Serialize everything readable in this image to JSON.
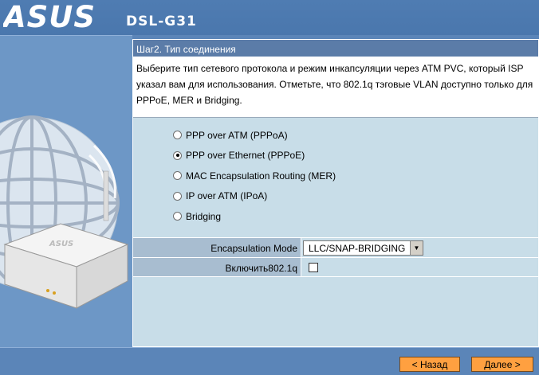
{
  "header": {
    "brand": "ASUS",
    "model": "DSL-G31"
  },
  "step": {
    "title": "Шаг2. Тип соединения",
    "description": "Выберите тип сетевого протокола и режим инкапсуляции через ATM PVC, который ISP указал вам для использования. Отметьте, что 802.1q тэговые VLAN доступно только для PPPoE, MER и Bridging."
  },
  "options": [
    {
      "label": "PPP over ATM (PPPoA)",
      "selected": false
    },
    {
      "label": "PPP over Ethernet (PPPoE)",
      "selected": true
    },
    {
      "label": "MAC Encapsulation Routing (MER)",
      "selected": false
    },
    {
      "label": "IP over ATM (IPoA)",
      "selected": false
    },
    {
      "label": "Bridging",
      "selected": false
    }
  ],
  "encapsulation": {
    "label": "Encapsulation Mode",
    "value": "LLC/SNAP-BRIDGING"
  },
  "vlan": {
    "label": "Включить802.1q",
    "checked": false
  },
  "buttons": {
    "back": "< Назад",
    "next": "Далее >"
  },
  "colors": {
    "background": "#5b85b8",
    "panel": "#c8dde8",
    "title_bar": "#5b7ca8",
    "button": "#ffa040"
  }
}
